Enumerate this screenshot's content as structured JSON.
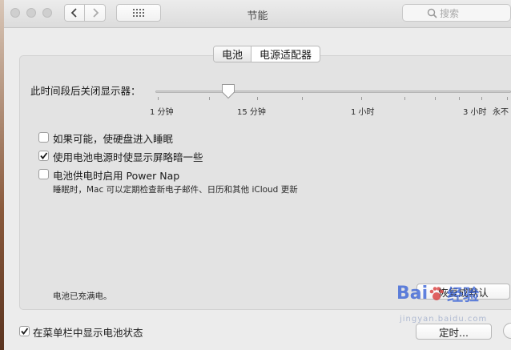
{
  "toolbar": {
    "title": "节能",
    "search_placeholder": "搜索"
  },
  "tabs": [
    {
      "label": "电池",
      "active": true
    },
    {
      "label": "电源适配器",
      "active": false
    }
  ],
  "display_sleep": {
    "label": "此时间段后关闭显示器：",
    "slider_value_minutes": 15,
    "ticks": {
      "t1": "1 分钟",
      "t15": "15 分钟",
      "t1h": "1 小时",
      "t3h": "3 小时",
      "never": "永不"
    }
  },
  "options": [
    {
      "label": "如果可能，使硬盘进入睡眠",
      "checked": false
    },
    {
      "label": "使用电池电源时使显示屏略暗一些",
      "checked": true
    },
    {
      "label": "电池供电时启用 Power Nap",
      "checked": false,
      "description": "睡眠时，Mac 可以定期检查新电子邮件、日历和其他 iCloud 更新"
    }
  ],
  "status": "电池已充满电。",
  "restore_defaults_label": "恢复成默认",
  "show_in_menubar": {
    "label": "在菜单栏中显示电池状态",
    "checked": true
  },
  "schedule_label": "定时...",
  "watermark": {
    "brand_left": "Bai",
    "brand_right": "经验",
    "url": "jingyan.baidu.com"
  },
  "colors": {
    "accent_check": "#1a1a1a",
    "watermark_blue": "#2f5bd6",
    "watermark_red": "#d8302f"
  }
}
